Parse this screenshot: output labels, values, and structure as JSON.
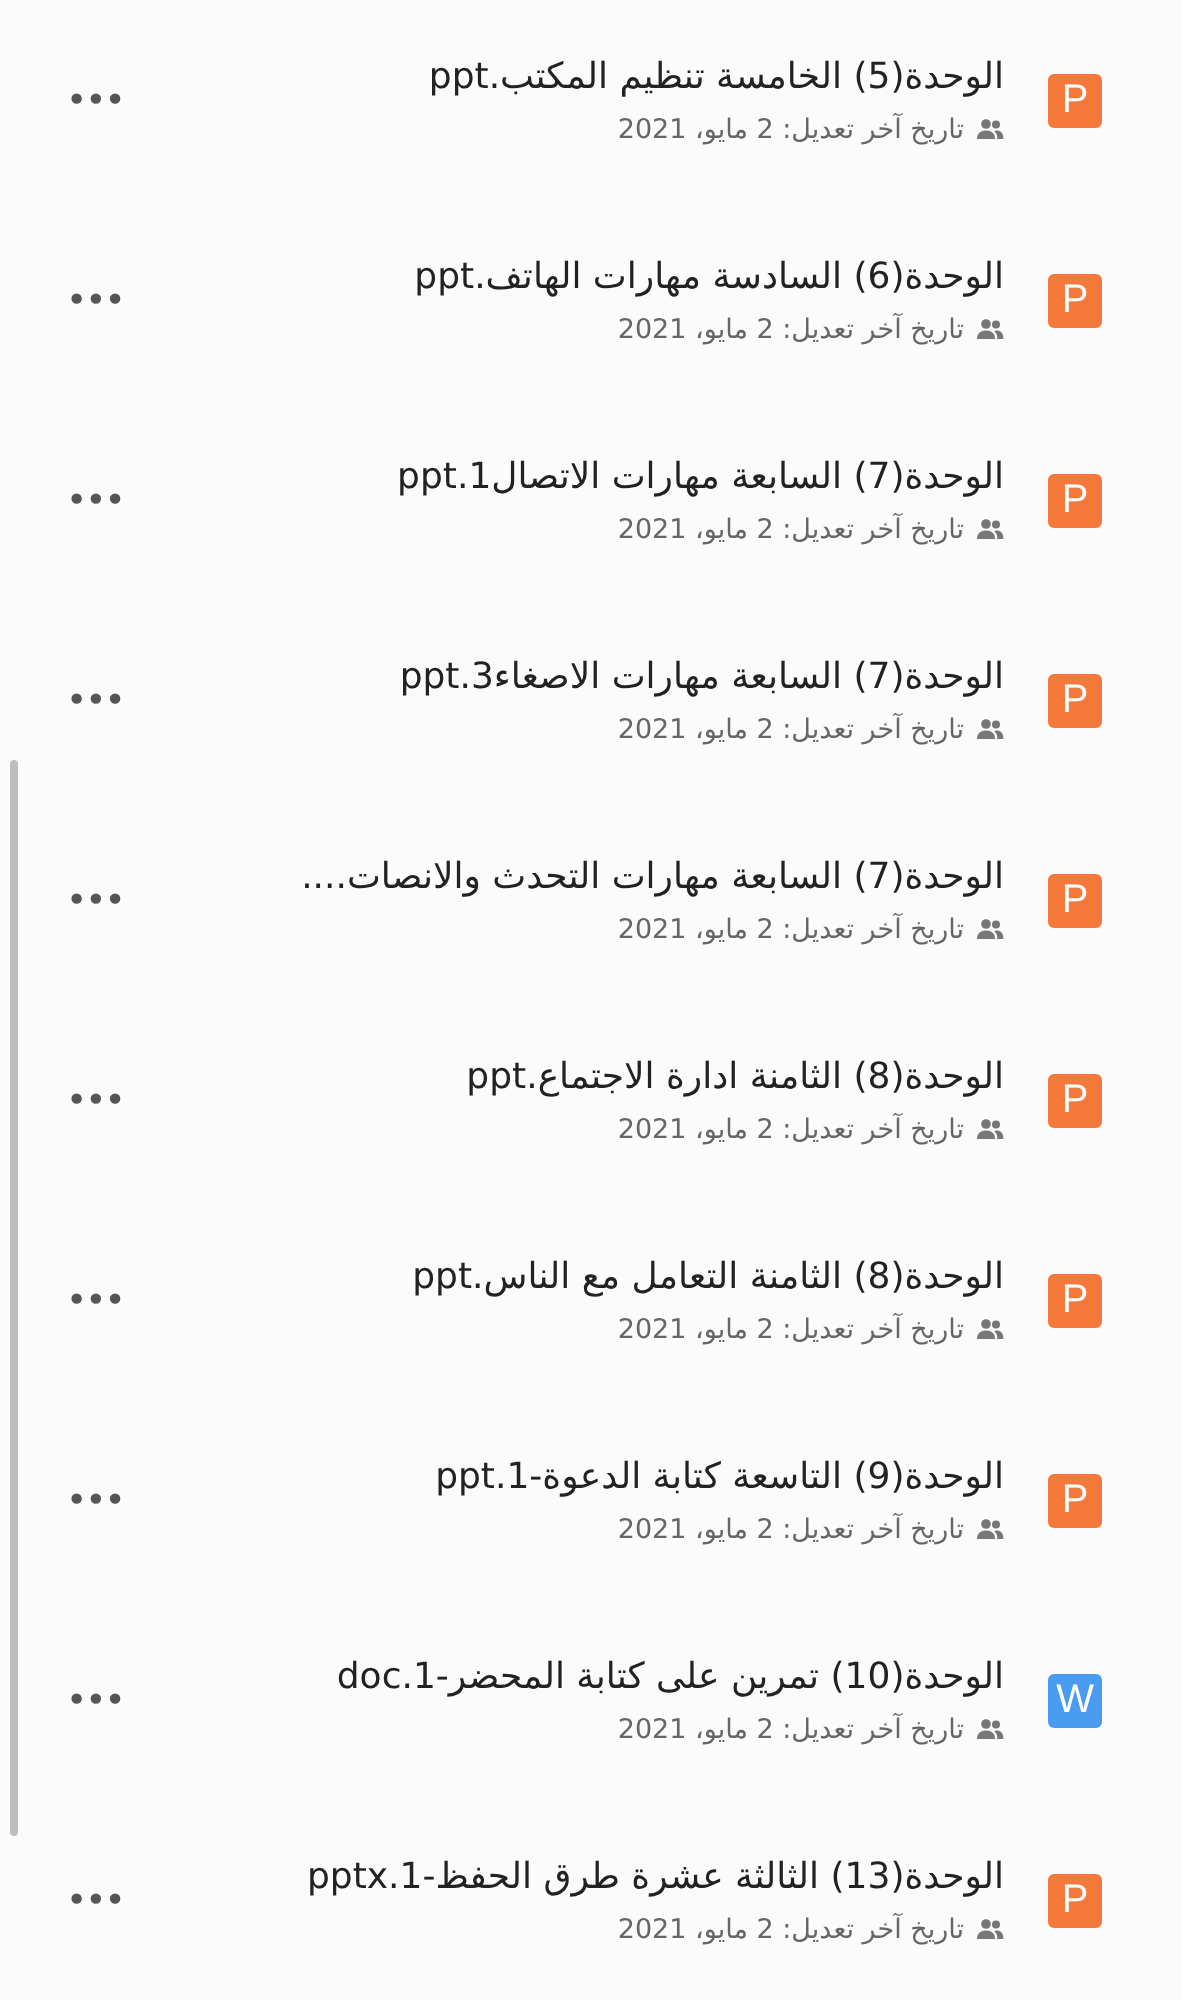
{
  "files": [
    {
      "kind": "powerpoint",
      "badge": "P",
      "name": "الوحدة(5) الخامسة تنظيم المكتب.ppt",
      "modified": "تاريخ آخر تعديل: 2 مايو، 2021",
      "menu": "•••"
    },
    {
      "kind": "powerpoint",
      "badge": "P",
      "name": "الوحدة(6) السادسة مهارات الهاتف.ppt",
      "modified": "تاريخ آخر تعديل: 2 مايو، 2021",
      "menu": "•••"
    },
    {
      "kind": "powerpoint",
      "badge": "P",
      "name": "الوحدة(7) السابعة مهارات الاتصال1.ppt",
      "modified": "تاريخ آخر تعديل: 2 مايو، 2021",
      "menu": "•••"
    },
    {
      "kind": "powerpoint",
      "badge": "P",
      "name": "الوحدة(7) السابعة مهارات الاصغاء3.ppt",
      "modified": "تاريخ آخر تعديل: 2 مايو، 2021",
      "menu": "•••"
    },
    {
      "kind": "powerpoint",
      "badge": "P",
      "name": "الوحدة(7) السابعة مهارات التحدث والانصات....",
      "modified": "تاريخ آخر تعديل: 2 مايو، 2021",
      "menu": "•••"
    },
    {
      "kind": "powerpoint",
      "badge": "P",
      "name": "الوحدة(8) الثامنة ادارة الاجتماع.ppt",
      "modified": "تاريخ آخر تعديل: 2 مايو، 2021",
      "menu": "•••"
    },
    {
      "kind": "powerpoint",
      "badge": "P",
      "name": "الوحدة(8) الثامنة التعامل مع الناس.ppt",
      "modified": "تاريخ آخر تعديل: 2 مايو، 2021",
      "menu": "•••"
    },
    {
      "kind": "powerpoint",
      "badge": "P",
      "name": "الوحدة(9) التاسعة كتابة الدعوة-1.ppt",
      "modified": "تاريخ آخر تعديل: 2 مايو، 2021",
      "menu": "•••"
    },
    {
      "kind": "word",
      "badge": "W",
      "name": "الوحدة(10) تمرين على كتابة المحضر-1.doc",
      "modified": "تاريخ آخر تعديل: 2 مايو، 2021",
      "menu": "•••"
    },
    {
      "kind": "powerpoint",
      "badge": "P",
      "name": "الوحدة(13) الثالثة عشرة طرق الحفظ-1.pptx",
      "modified": "تاريخ آخر تعديل: 2 مايو، 2021",
      "menu": "•••"
    }
  ]
}
